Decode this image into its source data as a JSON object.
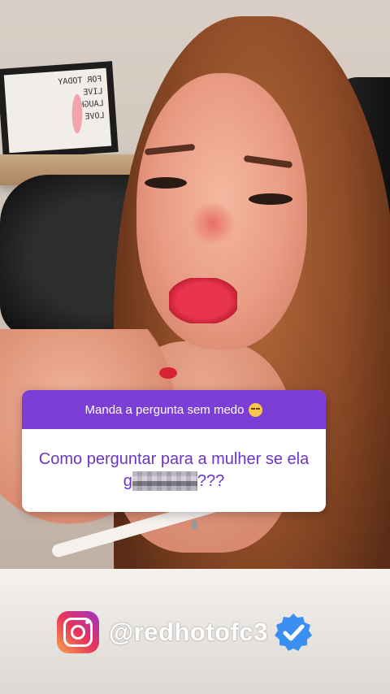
{
  "background": {
    "frame_text": [
      "FOR TODAY",
      "LIVE",
      "LAUGH",
      "LOVE"
    ]
  },
  "question_sticker": {
    "prompt": "Manda a pergunta sem medo",
    "prompt_emoji": "pensive-face-icon",
    "question_start": "Como perguntar para a mulher se ela g",
    "question_end": "???",
    "header_color": "#7c3ed6",
    "text_color": "#6b35c9"
  },
  "watermark": {
    "icon": "instagram-icon",
    "handle": "@redhotofc3",
    "badge": "verified-badge-icon",
    "badge_color": "#3b8ff0"
  }
}
